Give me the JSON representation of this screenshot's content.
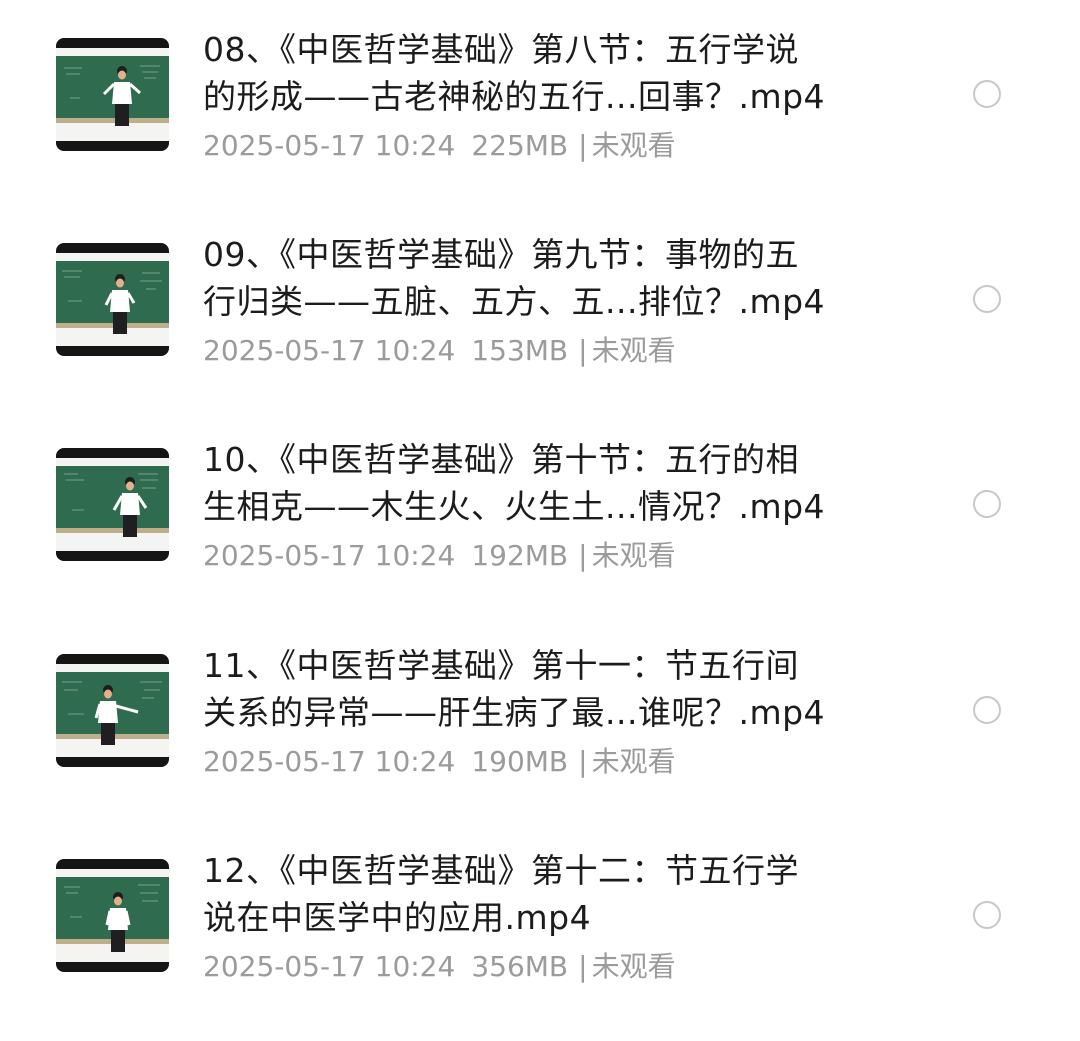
{
  "files": [
    {
      "title_line1": "08、《中医哲学基础》第八节：五行学说",
      "title_line2": "的形成——古老神秘的五行...回事？.mp4",
      "date": "2025-05-17 10:24",
      "size": "225MB",
      "separator": "|",
      "status": "未观看",
      "icon": "video-thumbnail"
    },
    {
      "title_line1": "09、《中医哲学基础》第九节：事物的五",
      "title_line2": "行归类——五脏、五方、五...排位？.mp4",
      "date": "2025-05-17 10:24",
      "size": "153MB",
      "separator": "|",
      "status": "未观看",
      "icon": "video-thumbnail"
    },
    {
      "title_line1": "10、《中医哲学基础》第十节：五行的相",
      "title_line2": "生相克——木生火、火生土...情况？.mp4",
      "date": "2025-05-17 10:24",
      "size": "192MB",
      "separator": "|",
      "status": "未观看",
      "icon": "video-thumbnail"
    },
    {
      "title_line1": "11、《中医哲学基础》第十一：节五行间",
      "title_line2": "关系的异常——肝生病了最...谁呢？.mp4",
      "date": "2025-05-17 10:24",
      "size": "190MB",
      "separator": "|",
      "status": "未观看",
      "icon": "video-thumbnail"
    },
    {
      "title_line1": "12、《中医哲学基础》第十二：节五行学",
      "title_line2": "说在中医学中的应用.mp4",
      "date": "2025-05-17 10:24",
      "size": "356MB",
      "separator": "|",
      "status": "未观看",
      "icon": "video-thumbnail"
    }
  ],
  "colors": {
    "title": "#1c1c1c",
    "meta": "#9b9b9b",
    "radio_border": "#c8c8c8",
    "chalkboard": "#2f6b4f"
  }
}
